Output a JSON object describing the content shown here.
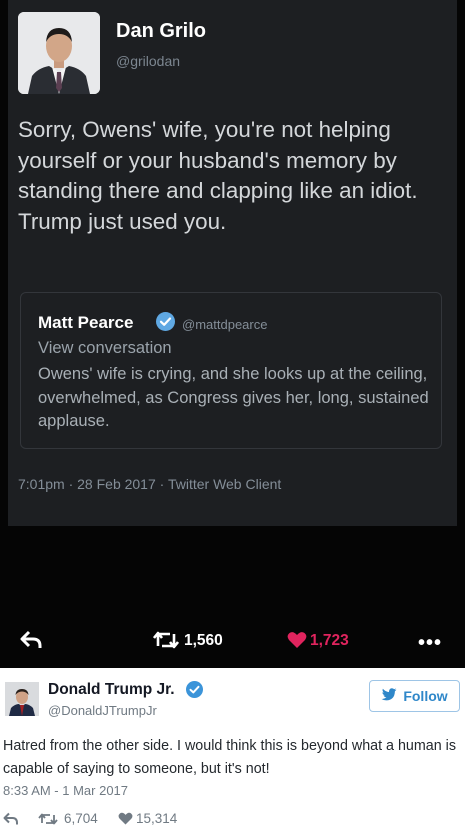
{
  "screenshot_tweet": {
    "author_name": "Dan Grilo",
    "author_handle": "@grilodan",
    "text": "Sorry, Owens' wife, you're not helping yourself or your husband's memory by standing there and clapping like an idiot. Trump just used you.",
    "quoted": {
      "author_name": "Matt Pearce",
      "author_handle": "@mattdpearce",
      "view_conversation": "View conversation",
      "text": "Owens' wife is crying, and she looks up at the ceiling, overwhelmed, as Congress gives her, long, sustained applause."
    },
    "meta": "7:01pm · 28 Feb 2017 · Twitter Web Client",
    "retweets": "1,560",
    "likes": "1,723",
    "icons": [
      "reply-icon",
      "retweet-icon",
      "heart-icon",
      "more-icon",
      "verified-icon"
    ]
  },
  "embed_tweet": {
    "author_name": "Donald Trump Jr.",
    "author_handle": "@DonaldJTrumpJr",
    "follow_label": "Follow",
    "text": "Hatred from the other side. I would think this is beyond what a human is capable of saying to someone, but it's not!",
    "meta": "8:33 AM - 1 Mar 2017",
    "retweets": "6,704",
    "likes": "15,314",
    "icons": [
      "twitter-bird-icon",
      "reply-icon",
      "retweet-icon",
      "heart-icon",
      "verified-icon"
    ]
  },
  "colors": {
    "dark_background": "#050505",
    "tweet_card": "#1d1f22",
    "like_red": "#e0245e",
    "twitter_blue": "#3b94d9"
  }
}
